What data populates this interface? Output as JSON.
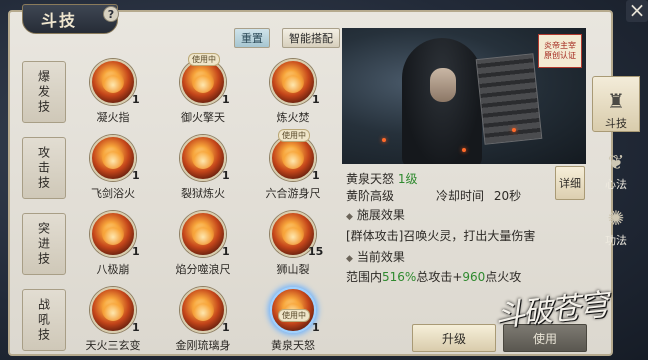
{
  "window": {
    "title": "斗技",
    "help": "?",
    "close": "×"
  },
  "toolbar": {
    "reset": "重置",
    "smart": "智能搭配"
  },
  "categories": [
    {
      "label": "爆发技",
      "skills": [
        {
          "name": "凝火指",
          "count": "1",
          "in_use": ""
        },
        {
          "name": "御火擎天",
          "count": "1",
          "in_use": "使用中"
        },
        {
          "name": "炼火焚",
          "count": "1",
          "in_use": ""
        }
      ]
    },
    {
      "label": "攻击技",
      "skills": [
        {
          "name": "飞剑浴火",
          "count": "1",
          "in_use": ""
        },
        {
          "name": "裂狱炼火",
          "count": "1",
          "in_use": ""
        },
        {
          "name": "六合游身尺",
          "count": "1",
          "in_use": "使用中"
        }
      ]
    },
    {
      "label": "突进技",
      "skills": [
        {
          "name": "八极崩",
          "count": "1",
          "in_use": ""
        },
        {
          "name": "焰分噬浪尺",
          "count": "1",
          "in_use": ""
        },
        {
          "name": "狮山裂",
          "count": "15",
          "in_use": ""
        }
      ]
    },
    {
      "label": "战吼技",
      "skills": [
        {
          "name": "天火三玄变",
          "count": "1",
          "in_use": ""
        },
        {
          "name": "金刚琉璃身",
          "count": "1",
          "in_use": ""
        },
        {
          "name": "黄泉天怒",
          "count": "1",
          "in_use": "使用中"
        }
      ]
    }
  ],
  "preview": {
    "seal": "炎帝主宰 原创认证"
  },
  "detail": {
    "skill_name": "黄泉天怒",
    "level": "1级",
    "grade": "黄阶高级",
    "cooldown_label": "冷却时间",
    "cooldown_value": "20秒",
    "effect_header": "施展效果",
    "effect_text": "[群体攻击]召唤火灵，打出大量伤害",
    "current_header": "当前效果",
    "current_prefix": "范围内",
    "current_pct": "516%",
    "current_mid": "总攻击+",
    "current_flat": "960",
    "current_suffix": "点火攻",
    "detail_btn": "详细",
    "upgrade_btn": "升级",
    "use_btn": "使用"
  },
  "side_tabs": [
    {
      "label": "斗技",
      "icon": "tower-icon",
      "active": true
    },
    {
      "label": "心法",
      "icon": "leaf-icon",
      "active": false
    },
    {
      "label": "功法",
      "icon": "swirl-icon",
      "active": false
    }
  ],
  "watermark": "斗破苍穹",
  "colors": {
    "green": "#2f8a2f",
    "panel": "#e9e6df",
    "dark": "#262c36"
  }
}
